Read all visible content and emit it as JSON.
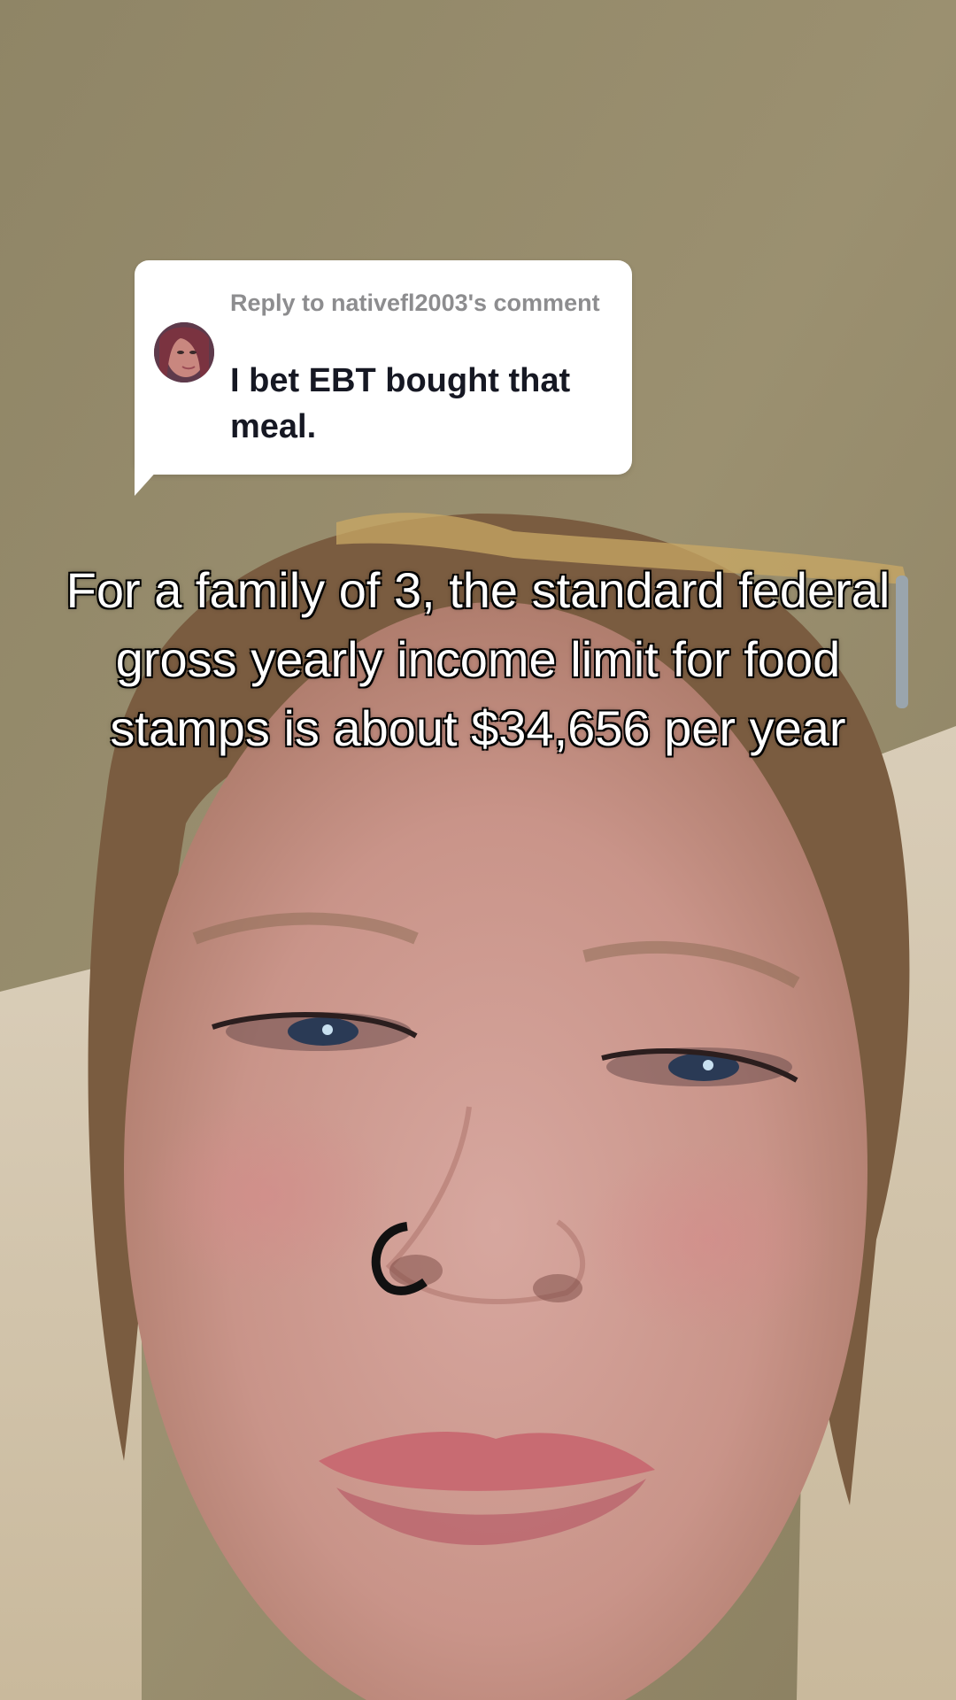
{
  "reply": {
    "header": "Reply to nativefl2003's comment",
    "body": "I bet EBT bought that meal."
  },
  "caption": {
    "text": "For a family of 3, the standard federal gross yearly income limit for food stamps is about $34,656 per year"
  },
  "colors": {
    "bubble_bg": "#ffffff",
    "reply_header": "#8d8d8f",
    "reply_body": "#161823",
    "caption_text": "#ffffff",
    "caption_outline": "#000000"
  }
}
